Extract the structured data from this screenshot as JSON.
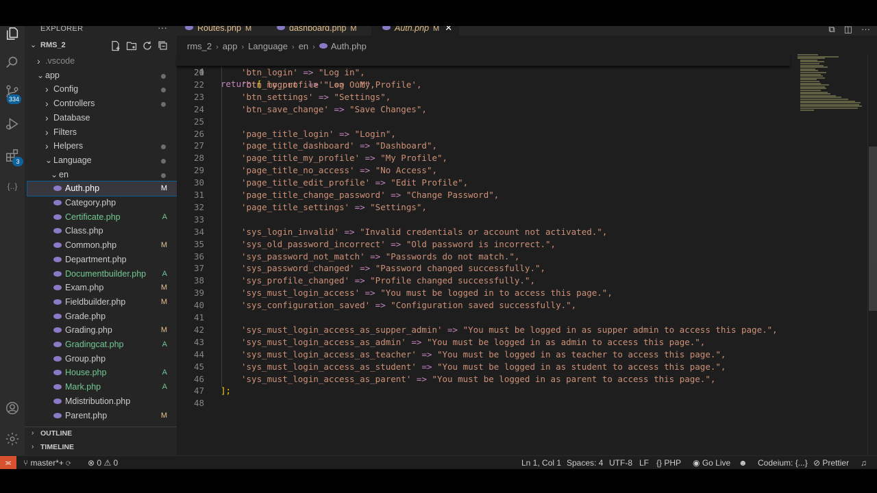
{
  "explorer": {
    "title": "EXPLORER",
    "more": "···",
    "project": "RMS_2",
    "tree": [
      {
        "label": ".vscode",
        "depth": 1,
        "kind": "folder-closed",
        "muted": true
      },
      {
        "label": "app",
        "depth": 1,
        "kind": "folder-open",
        "dot": true
      },
      {
        "label": "Config",
        "depth": 2,
        "kind": "folder-closed",
        "dot": true
      },
      {
        "label": "Controllers",
        "depth": 2,
        "kind": "folder-closed",
        "dot": true
      },
      {
        "label": "Database",
        "depth": 2,
        "kind": "folder-closed"
      },
      {
        "label": "Filters",
        "depth": 2,
        "kind": "folder-closed"
      },
      {
        "label": "Helpers",
        "depth": 2,
        "kind": "folder-closed",
        "dot": true
      },
      {
        "label": "Language",
        "depth": 2,
        "kind": "folder-open",
        "dot": true
      },
      {
        "label": "en",
        "depth": 3,
        "kind": "folder-open",
        "dot": true
      },
      {
        "label": "Auth.php",
        "depth": 4,
        "kind": "file",
        "status": "M",
        "selected": true
      },
      {
        "label": "Category.php",
        "depth": 4,
        "kind": "file"
      },
      {
        "label": "Certificate.php",
        "depth": 4,
        "kind": "file",
        "status": "A"
      },
      {
        "label": "Class.php",
        "depth": 4,
        "kind": "file"
      },
      {
        "label": "Common.php",
        "depth": 4,
        "kind": "file",
        "status": "M"
      },
      {
        "label": "Department.php",
        "depth": 4,
        "kind": "file"
      },
      {
        "label": "Documentbuilder.php",
        "depth": 4,
        "kind": "file",
        "status": "A"
      },
      {
        "label": "Exam.php",
        "depth": 4,
        "kind": "file",
        "status": "M"
      },
      {
        "label": "Fieldbuilder.php",
        "depth": 4,
        "kind": "file",
        "status": "M"
      },
      {
        "label": "Grade.php",
        "depth": 4,
        "kind": "file"
      },
      {
        "label": "Grading.php",
        "depth": 4,
        "kind": "file",
        "status": "M"
      },
      {
        "label": "Gradingcat.php",
        "depth": 4,
        "kind": "file",
        "status": "A"
      },
      {
        "label": "Group.php",
        "depth": 4,
        "kind": "file"
      },
      {
        "label": "House.php",
        "depth": 4,
        "kind": "file",
        "status": "A"
      },
      {
        "label": "Mark.php",
        "depth": 4,
        "kind": "file",
        "status": "A"
      },
      {
        "label": "Mdistribution.php",
        "depth": 4,
        "kind": "file"
      },
      {
        "label": "Parent.php",
        "depth": 4,
        "kind": "file",
        "status": "M"
      }
    ],
    "outline": "OUTLINE",
    "timeline": "TIMELINE"
  },
  "activity": {
    "source_control_badge": "334",
    "extensions_badge": "3"
  },
  "tabs": [
    {
      "label": "Routes.php",
      "status": "M",
      "active": false
    },
    {
      "label": "dashboard.php",
      "status": "M",
      "active": false
    },
    {
      "label": "Auth.php",
      "status": "M",
      "active": true,
      "close": "✕"
    }
  ],
  "breadcrumb": [
    "rms_2",
    "app",
    "Language",
    "en",
    "Auth.php"
  ],
  "editor": {
    "sticky": {
      "number": "4",
      "text": "return ["
    },
    "partial_line": {
      "number": "20",
      "text": "    'btn_my_profile'  =>  'My Profile',"
    },
    "lines": [
      {
        "n": "21",
        "key": "'btn_login'",
        "val": "\"Log in\","
      },
      {
        "n": "22",
        "key": "'btn_logout'",
        "val": "\"Log Out\","
      },
      {
        "n": "23",
        "key": "'btn_settings'",
        "val": "\"Settings\","
      },
      {
        "n": "24",
        "key": "'btn_save_change'",
        "val": "\"Save Changes\","
      },
      {
        "n": "25",
        "key": "",
        "val": ""
      },
      {
        "n": "26",
        "key": "'page_title_login'",
        "val": "\"Login\","
      },
      {
        "n": "27",
        "key": "'page_title_dashboard'",
        "val": "\"Dashboard\","
      },
      {
        "n": "28",
        "key": "'page_title_my_profile'",
        "val": "\"My Profile\","
      },
      {
        "n": "29",
        "key": "'page_title_no_access'",
        "val": "\"No Access\","
      },
      {
        "n": "30",
        "key": "'page_title_edit_profile'",
        "val": "\"Edit Profile\","
      },
      {
        "n": "31",
        "key": "'page_title_change_password'",
        "val": "\"Change Password\","
      },
      {
        "n": "32",
        "key": "'page_title_settings'",
        "val": "\"Settings\","
      },
      {
        "n": "33",
        "key": "",
        "val": ""
      },
      {
        "n": "34",
        "key": "'sys_login_invalid'",
        "val": "\"Invalid credentials or account not activated.\","
      },
      {
        "n": "35",
        "key": "'sys_old_password_incorrect'",
        "val": "\"Old password is incorrect.\","
      },
      {
        "n": "36",
        "key": "'sys_password_not_match'",
        "val": "\"Passwords do not match.\","
      },
      {
        "n": "37",
        "key": "'sys_password_changed'",
        "val": "\"Password changed successfully.\","
      },
      {
        "n": "38",
        "key": "'sys_profile_changed'",
        "val": "\"Profile changed successfully.\","
      },
      {
        "n": "39",
        "key": "'sys_must_login_access'",
        "val": "\"You must be logged in to access this page.\","
      },
      {
        "n": "40",
        "key": "'sys_configuration_saved'",
        "val": "\"Configuration saved successfully.\","
      },
      {
        "n": "41",
        "key": "",
        "val": ""
      },
      {
        "n": "42",
        "key": "'sys_must_login_access_as_supper_admin'",
        "val": "\"You must be logged in as supper admin to access this page.\","
      },
      {
        "n": "43",
        "key": "'sys_must_login_access_as_admin'",
        "val": "\"You must be logged in as admin to access this page.\","
      },
      {
        "n": "44",
        "key": "'sys_must_login_access_as_teacher'",
        "val": "\"You must be logged in as teacher to access this page.\","
      },
      {
        "n": "45",
        "key": "'sys_must_login_access_as_student'",
        "val": "\"You must be logged in as student to access this page.\","
      },
      {
        "n": "46",
        "key": "'sys_must_login_access_as_parent'",
        "val": "\"You must be logged in as parent to access this page.\","
      }
    ],
    "closing": {
      "n": "47",
      "text": "];"
    },
    "last": {
      "n": "48",
      "text": ""
    }
  },
  "statusbar": {
    "branch": "master*+",
    "errors": "0",
    "warnings": "0",
    "position": "Ln 1, Col 1",
    "spaces": "Spaces: 4",
    "encoding": "UTF-8",
    "eol": "LF",
    "language": "PHP",
    "golive": "Go Live",
    "codeium": "Codeium: {...}",
    "prettier": "Prettier"
  },
  "colors": {
    "modified": "#e2c08d",
    "added": "#73c991",
    "keyword": "#c586c0",
    "string": "#ce9178",
    "remote": "#d8512e"
  }
}
